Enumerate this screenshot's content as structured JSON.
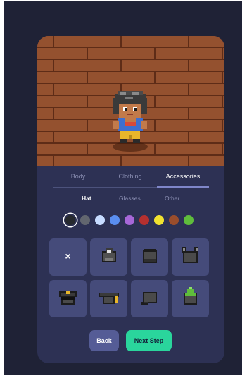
{
  "tabs": [
    {
      "label": "Body",
      "active": false
    },
    {
      "label": "Clothing",
      "active": false
    },
    {
      "label": "Accessories",
      "active": true
    }
  ],
  "subtabs": [
    {
      "label": "Hat",
      "active": true
    },
    {
      "label": "Glasses",
      "active": false
    },
    {
      "label": "Other",
      "active": false
    }
  ],
  "colors": [
    {
      "hex": "#26292e",
      "selected": true
    },
    {
      "hex": "#62666f",
      "selected": false
    },
    {
      "hex": "#c7dcff",
      "selected": false
    },
    {
      "hex": "#5a8ef0",
      "selected": false
    },
    {
      "hex": "#a767d8",
      "selected": false
    },
    {
      "hex": "#b5302f",
      "selected": false
    },
    {
      "hex": "#f1e230",
      "selected": false
    },
    {
      "hex": "#9a4d2c",
      "selected": false
    },
    {
      "hex": "#5fbd3c",
      "selected": false
    }
  ],
  "items": [
    {
      "icon": "none-x-icon",
      "label": "×"
    },
    {
      "icon": "headset-hat-icon"
    },
    {
      "icon": "beanie-hat-icon"
    },
    {
      "icon": "cat-ears-hat-icon"
    },
    {
      "icon": "police-cap-icon"
    },
    {
      "icon": "graduation-cap-icon"
    },
    {
      "icon": "baseball-cap-icon"
    },
    {
      "icon": "green-hood-icon"
    }
  ],
  "buttons": {
    "back": "Back",
    "next": "Next Step"
  }
}
